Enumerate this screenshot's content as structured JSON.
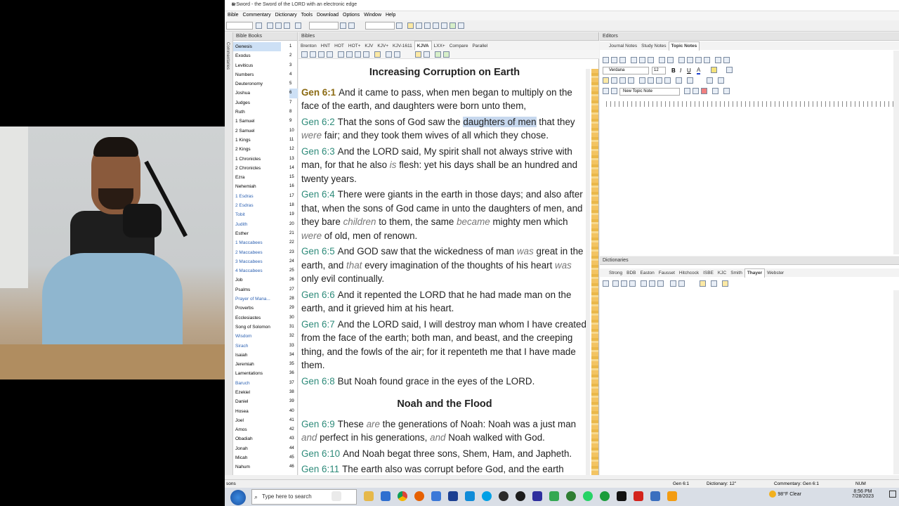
{
  "app": {
    "title": "e-Sword - the Sword of the LORD with an electronic edge",
    "menu": [
      "Bible",
      "Commentary",
      "Dictionary",
      "Tools",
      "Download",
      "Options",
      "Window",
      "Help"
    ]
  },
  "side_tab": "Commentaries",
  "books_panel": {
    "title": "Bible Books",
    "books": [
      "Genesis",
      "Exodus",
      "Leviticus",
      "Numbers",
      "Deuteronomy",
      "Joshua",
      "Judges",
      "Ruth",
      "1 Samuel",
      "2 Samuel",
      "1 Kings",
      "2 Kings",
      "1 Chronicles",
      "2 Chronicles",
      "Ezra",
      "Nehemiah",
      "1 Esdras",
      "2 Esdras",
      "Tobit",
      "Judith",
      "Esther",
      "1 Maccabees",
      "2 Maccabees",
      "3 Maccabees",
      "4 Maccabees",
      "Job",
      "Psalms",
      "Prayer of Mana...",
      "Proverbs",
      "Ecclesiastes",
      "Song of Solomon",
      "Wisdom",
      "Sirach",
      "Isaiah",
      "Jeremiah",
      "Lamentations",
      "Baruch",
      "Ezekiel",
      "Daniel",
      "Hosea",
      "Joel",
      "Amos",
      "Obadiah",
      "Jonah",
      "Micah",
      "Nahum"
    ],
    "apocrypha": [
      "1 Esdras",
      "2 Esdras",
      "Tobit",
      "Judith",
      "1 Maccabees",
      "2 Maccabees",
      "3 Maccabees",
      "4 Maccabees",
      "Prayer of Mana...",
      "Wisdom",
      "Sirach",
      "Baruch"
    ],
    "chapters": [
      "1",
      "2",
      "3",
      "4",
      "5",
      "6",
      "7",
      "8",
      "9",
      "10",
      "11",
      "12",
      "13",
      "14",
      "15",
      "16",
      "17",
      "18",
      "19",
      "20",
      "21",
      "22",
      "23",
      "24",
      "25",
      "26",
      "27",
      "28",
      "29",
      "30",
      "31",
      "32",
      "33",
      "34",
      "35",
      "36",
      "37",
      "38",
      "39",
      "40",
      "41",
      "42",
      "43",
      "44",
      "45",
      "46"
    ]
  },
  "bibles_panel": {
    "title": "Bibles",
    "tabs": [
      "Brenton",
      "HNT",
      "HOT",
      "HOT+",
      "KJV",
      "KJV+",
      "KJV-1611",
      "KJVA",
      "LXX+",
      "Compare",
      "Parallel"
    ],
    "active_tab": "KJVA",
    "heading1": "Increasing Corruption on Earth",
    "heading2": "Noah and the Flood",
    "verses": [
      {
        "ref": "Gen 6:1",
        "parts": [
          [
            "n",
            "And it came to pass, when men began to multiply on the face of the earth, and daughters were born unto them,"
          ]
        ]
      },
      {
        "ref": "Gen 6:2",
        "parts": [
          [
            "n",
            "That the sons of God saw the "
          ],
          [
            "h",
            "daughters of men"
          ],
          [
            "n",
            " that they "
          ],
          [
            "i",
            "were"
          ],
          [
            "n",
            " fair; and they took them wives of all which they chose."
          ]
        ]
      },
      {
        "ref": "Gen 6:3",
        "parts": [
          [
            "n",
            "And the LORD said, My spirit shall not always strive with man, for that he also "
          ],
          [
            "i",
            "is"
          ],
          [
            "n",
            " flesh: yet his days shall be an hundred and twenty years."
          ]
        ]
      },
      {
        "ref": "Gen 6:4",
        "parts": [
          [
            "n",
            "There were giants in the earth in those days; and also after that, when the sons of God came in unto the daughters of men, and they bare "
          ],
          [
            "i",
            "children"
          ],
          [
            "n",
            " to them, the same "
          ],
          [
            "i",
            "became"
          ],
          [
            "n",
            " mighty men which "
          ],
          [
            "i",
            "were"
          ],
          [
            "n",
            " of old, men of renown."
          ]
        ]
      },
      {
        "ref": "Gen 6:5",
        "parts": [
          [
            "n",
            "And GOD saw that the wickedness of man "
          ],
          [
            "i",
            "was"
          ],
          [
            "n",
            " great in the earth, and "
          ],
          [
            "i",
            "that"
          ],
          [
            "n",
            " every imagination of the thoughts of his heart "
          ],
          [
            "i",
            "was"
          ],
          [
            "n",
            " only evil continually."
          ]
        ]
      },
      {
        "ref": "Gen 6:6",
        "parts": [
          [
            "n",
            "And it repented the LORD that he had made man on the earth, and it grieved him at his heart."
          ]
        ]
      },
      {
        "ref": "Gen 6:7",
        "parts": [
          [
            "n",
            "And the LORD said, I will destroy man whom I have created from the face of the earth; both man, and beast, and the creeping thing, and the fowls of the air; for it repenteth me that I have made them."
          ]
        ]
      },
      {
        "ref": "Gen 6:8",
        "parts": [
          [
            "n",
            "But Noah found grace in the eyes of the LORD."
          ]
        ]
      }
    ],
    "verses2": [
      {
        "ref": "Gen 6:9",
        "parts": [
          [
            "n",
            "These "
          ],
          [
            "i",
            "are"
          ],
          [
            "n",
            " the generations of Noah: Noah was a just man "
          ],
          [
            "i",
            "and"
          ],
          [
            "n",
            " perfect in his generations, "
          ],
          [
            "i",
            "and"
          ],
          [
            "n",
            " Noah walked with God."
          ]
        ]
      },
      {
        "ref": "Gen 6:10",
        "parts": [
          [
            "n",
            "And Noah begat three sons, Shem, Ham, and Japheth."
          ]
        ]
      },
      {
        "ref": "Gen 6:11",
        "parts": [
          [
            "n",
            "The earth also was corrupt before God, and the earth"
          ]
        ]
      }
    ]
  },
  "editors_panel": {
    "title": "Editors",
    "tabs": [
      "Journal Notes",
      "Study Notes",
      "Topic Notes"
    ],
    "active_tab": "Topic Notes",
    "font": "Verdana",
    "size": "12",
    "topic": "New Topic Note"
  },
  "dict_panel": {
    "title": "Dictionaries",
    "tabs": [
      "Strong",
      "BDB",
      "Easton",
      "Fausset",
      "Hitchcock",
      "ISBE",
      "KJC",
      "Smith",
      "Thayer",
      "Webster"
    ],
    "active_tab": "Thayer"
  },
  "status": {
    "left": "sons",
    "verse": "Gen 6:1",
    "dictionary": "Dictionary: 12\"",
    "commentary": "Commentary: Gen 6:1",
    "num": "NUM"
  },
  "taskbar": {
    "search_placeholder": "Type here to search",
    "weather": "98°F  Clear",
    "time": "8:56 PM",
    "date": "7/28/2023"
  }
}
